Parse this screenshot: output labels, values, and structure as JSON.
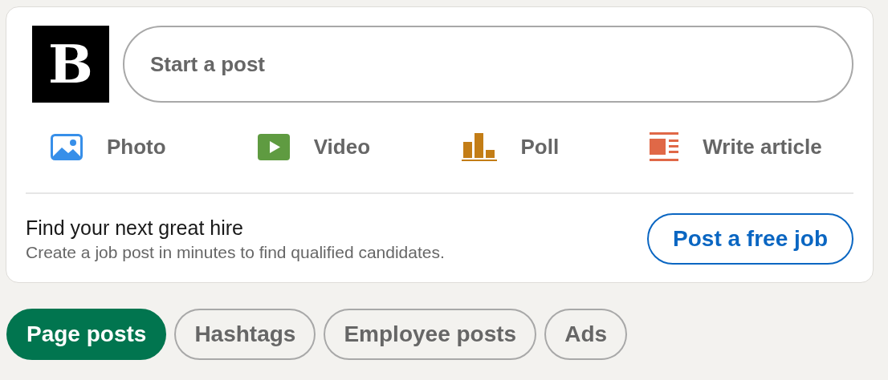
{
  "composer": {
    "logo_letter": "B",
    "placeholder": "Start a post",
    "actions": [
      {
        "kind": "photo",
        "label": "Photo"
      },
      {
        "kind": "video",
        "label": "Video"
      },
      {
        "kind": "poll",
        "label": "Poll"
      },
      {
        "kind": "article",
        "label": "Write article"
      }
    ]
  },
  "hire": {
    "title": "Find your next great hire",
    "subtitle": "Create a job post in minutes to find qualified candidates.",
    "button": "Post a free job"
  },
  "filters": [
    {
      "label": "Page posts",
      "selected": true
    },
    {
      "label": "Hashtags",
      "selected": false
    },
    {
      "label": "Employee posts",
      "selected": false
    },
    {
      "label": "Ads",
      "selected": false
    }
  ]
}
